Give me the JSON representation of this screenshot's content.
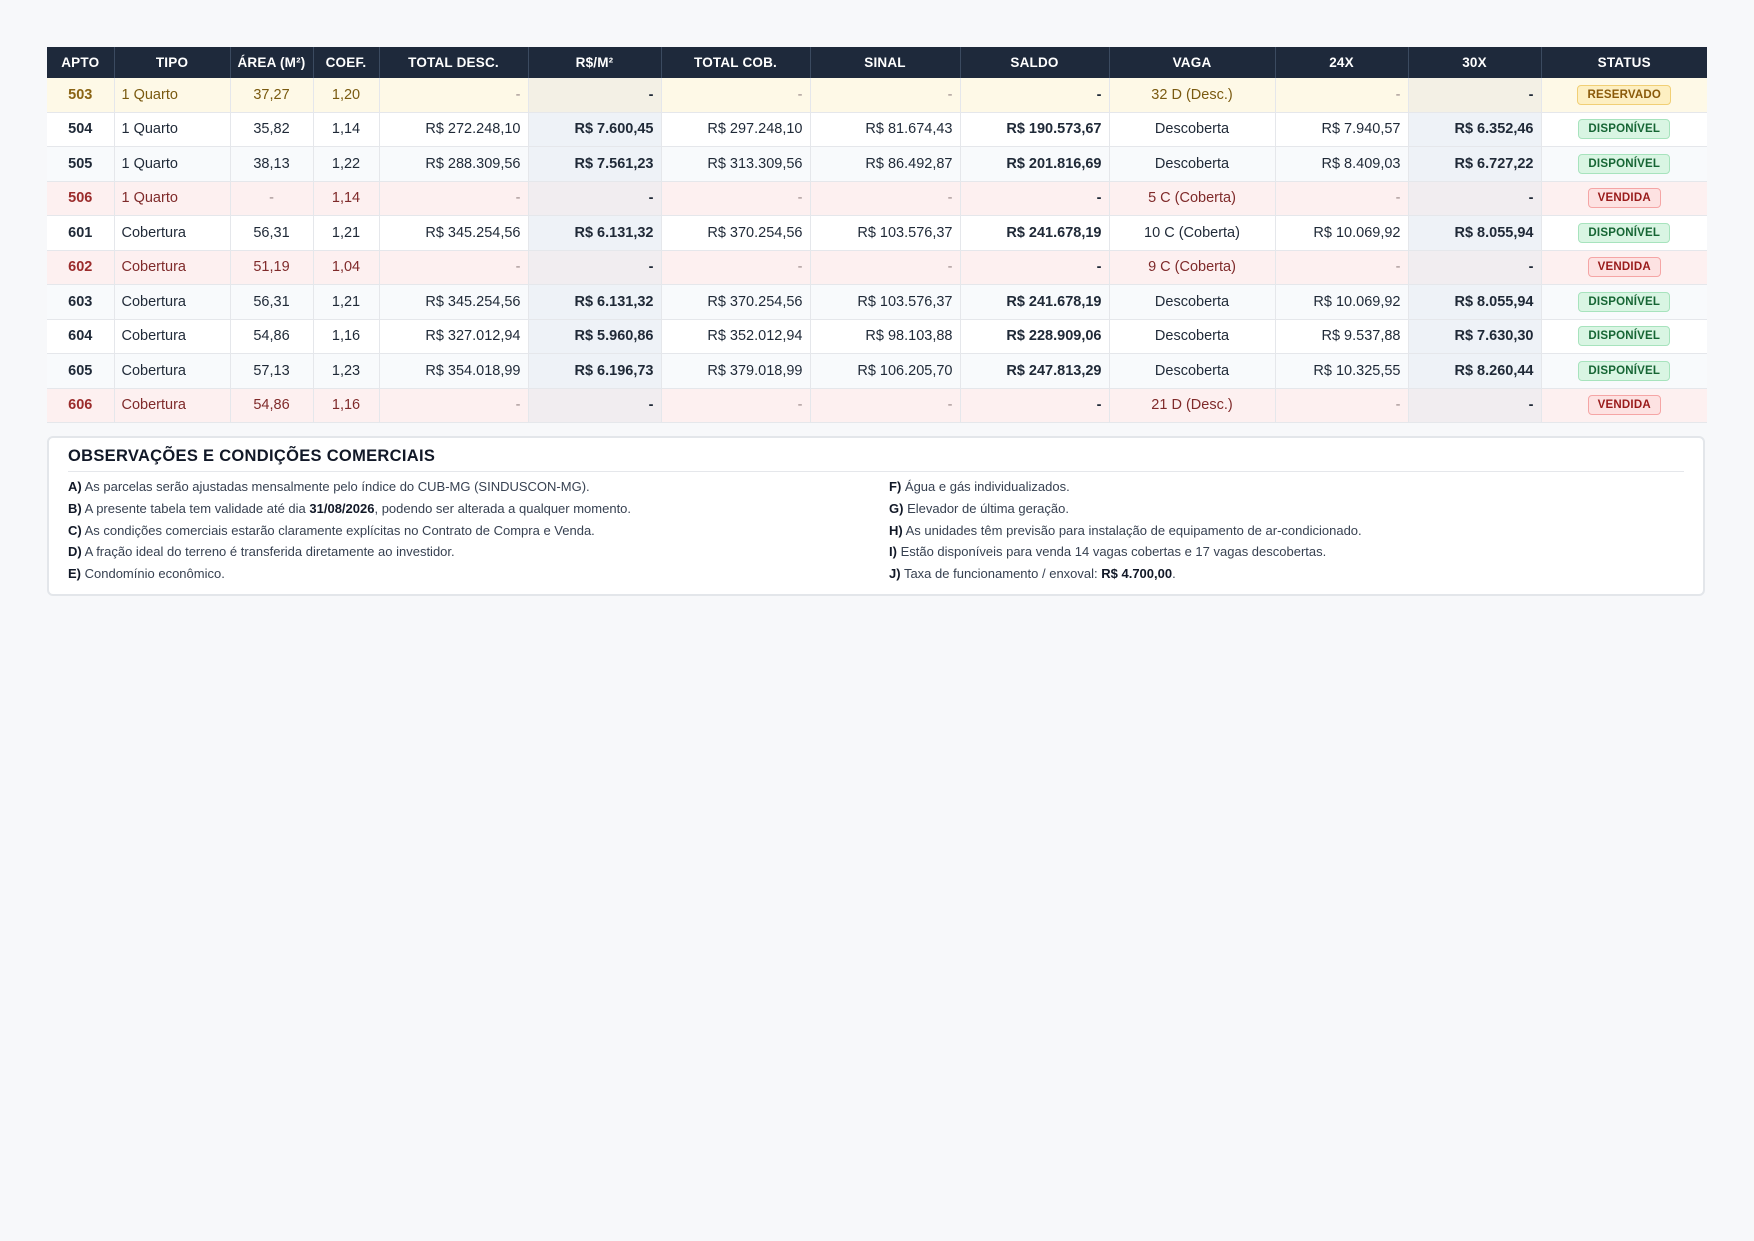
{
  "table": {
    "headers": [
      "APTO",
      "TIPO",
      "ÁREA (M²)",
      "COEF.",
      "TOTAL DESC.",
      "R$/M²",
      "TOTAL COB.",
      "SINAL",
      "SALDO",
      "VAGA",
      "24X",
      "30X",
      "STATUS"
    ],
    "rows": [
      {
        "apto": "503",
        "tipo": "1 Quarto",
        "area": "37,27",
        "coef": "1,20",
        "total_desc": "-",
        "rs_m2": "-",
        "total_cob": "-",
        "sinal": "-",
        "saldo": "-",
        "vaga": "32 D (Desc.)",
        "x24": "-",
        "x30": "-",
        "status": "RESERVADO",
        "kind": "reserved"
      },
      {
        "apto": "504",
        "tipo": "1 Quarto",
        "area": "35,82",
        "coef": "1,14",
        "total_desc": "R$ 272.248,10",
        "rs_m2": "R$ 7.600,45",
        "total_cob": "R$ 297.248,10",
        "sinal": "R$ 81.674,43",
        "saldo": "R$ 190.573,67",
        "vaga": "Descoberta",
        "x24": "R$ 7.940,57",
        "x30": "R$ 6.352,46",
        "status": "DISPONÍVEL",
        "kind": "avail"
      },
      {
        "apto": "505",
        "tipo": "1 Quarto",
        "area": "38,13",
        "coef": "1,22",
        "total_desc": "R$ 288.309,56",
        "rs_m2": "R$ 7.561,23",
        "total_cob": "R$ 313.309,56",
        "sinal": "R$ 86.492,87",
        "saldo": "R$ 201.816,69",
        "vaga": "Descoberta",
        "x24": "R$ 8.409,03",
        "x30": "R$ 6.727,22",
        "status": "DISPONÍVEL",
        "kind": "avail"
      },
      {
        "apto": "506",
        "tipo": "1 Quarto",
        "area": "-",
        "coef": "1,14",
        "total_desc": "-",
        "rs_m2": "-",
        "total_cob": "-",
        "sinal": "-",
        "saldo": "-",
        "vaga": "5 C (Coberta)",
        "x24": "-",
        "x30": "-",
        "status": "VENDIDA",
        "kind": "sold"
      },
      {
        "apto": "601",
        "tipo": "Cobertura",
        "area": "56,31",
        "coef": "1,21",
        "total_desc": "R$ 345.254,56",
        "rs_m2": "R$ 6.131,32",
        "total_cob": "R$ 370.254,56",
        "sinal": "R$ 103.576,37",
        "saldo": "R$ 241.678,19",
        "vaga": "10 C (Coberta)",
        "x24": "R$ 10.069,92",
        "x30": "R$ 8.055,94",
        "status": "DISPONÍVEL",
        "kind": "avail"
      },
      {
        "apto": "602",
        "tipo": "Cobertura",
        "area": "51,19",
        "coef": "1,04",
        "total_desc": "-",
        "rs_m2": "-",
        "total_cob": "-",
        "sinal": "-",
        "saldo": "-",
        "vaga": "9 C (Coberta)",
        "x24": "-",
        "x30": "-",
        "status": "VENDIDA",
        "kind": "sold"
      },
      {
        "apto": "603",
        "tipo": "Cobertura",
        "area": "56,31",
        "coef": "1,21",
        "total_desc": "R$ 345.254,56",
        "rs_m2": "R$ 6.131,32",
        "total_cob": "R$ 370.254,56",
        "sinal": "R$ 103.576,37",
        "saldo": "R$ 241.678,19",
        "vaga": "Descoberta",
        "x24": "R$ 10.069,92",
        "x30": "R$ 8.055,94",
        "status": "DISPONÍVEL",
        "kind": "avail"
      },
      {
        "apto": "604",
        "tipo": "Cobertura",
        "area": "54,86",
        "coef": "1,16",
        "total_desc": "R$ 327.012,94",
        "rs_m2": "R$ 5.960,86",
        "total_cob": "R$ 352.012,94",
        "sinal": "R$ 98.103,88",
        "saldo": "R$ 228.909,06",
        "vaga": "Descoberta",
        "x24": "R$ 9.537,88",
        "x30": "R$ 7.630,30",
        "status": "DISPONÍVEL",
        "kind": "avail"
      },
      {
        "apto": "605",
        "tipo": "Cobertura",
        "area": "57,13",
        "coef": "1,23",
        "total_desc": "R$ 354.018,99",
        "rs_m2": "R$ 6.196,73",
        "total_cob": "R$ 379.018,99",
        "sinal": "R$ 106.205,70",
        "saldo": "R$ 247.813,29",
        "vaga": "Descoberta",
        "x24": "R$ 10.325,55",
        "x30": "R$ 8.260,44",
        "status": "DISPONÍVEL",
        "kind": "avail"
      },
      {
        "apto": "606",
        "tipo": "Cobertura",
        "area": "54,86",
        "coef": "1,16",
        "total_desc": "-",
        "rs_m2": "-",
        "total_cob": "-",
        "sinal": "-",
        "saldo": "-",
        "vaga": "21 D (Desc.)",
        "x24": "-",
        "x30": "-",
        "status": "VENDIDA",
        "kind": "sold"
      }
    ]
  },
  "notes": {
    "title": "OBSERVAÇÕES E CONDIÇÕES COMERCIAIS",
    "left": [
      {
        "key": "A)",
        "text": "As parcelas serão ajustadas mensalmente pelo índice do CUB-MG (SINDUSCON-MG)."
      },
      {
        "key": "B)",
        "text_pre": "A presente tabela tem validade até dia ",
        "strong": "31/08/2026",
        "text_post": ", podendo ser alterada a qualquer momento."
      },
      {
        "key": "C)",
        "text": "As condições comerciais estarão claramente explícitas no Contrato de Compra e Venda."
      },
      {
        "key": "D)",
        "text": "A fração ideal do terreno é transferida diretamente ao investidor."
      },
      {
        "key": "E)",
        "text": "Condomínio econômico."
      }
    ],
    "right": [
      {
        "key": "F)",
        "text": "Água e gás individualizados."
      },
      {
        "key": "G)",
        "text": "Elevador de última geração."
      },
      {
        "key": "H)",
        "text": "As unidades têm previsão para instalação de equipamento de ar-condicionado."
      },
      {
        "key": "I)",
        "text": "Estão disponíveis para venda 14 vagas cobertas e 17 vagas descobertas."
      },
      {
        "key": "J)",
        "text_pre": "Taxa de funcionamento / enxoval: ",
        "strong": "R$ 4.700,00",
        "text_post": "."
      }
    ]
  },
  "colors": {
    "header_bg": "#1e293b",
    "available": "#166534",
    "sold": "#991b1b",
    "reserved": "#8a5a0a"
  }
}
